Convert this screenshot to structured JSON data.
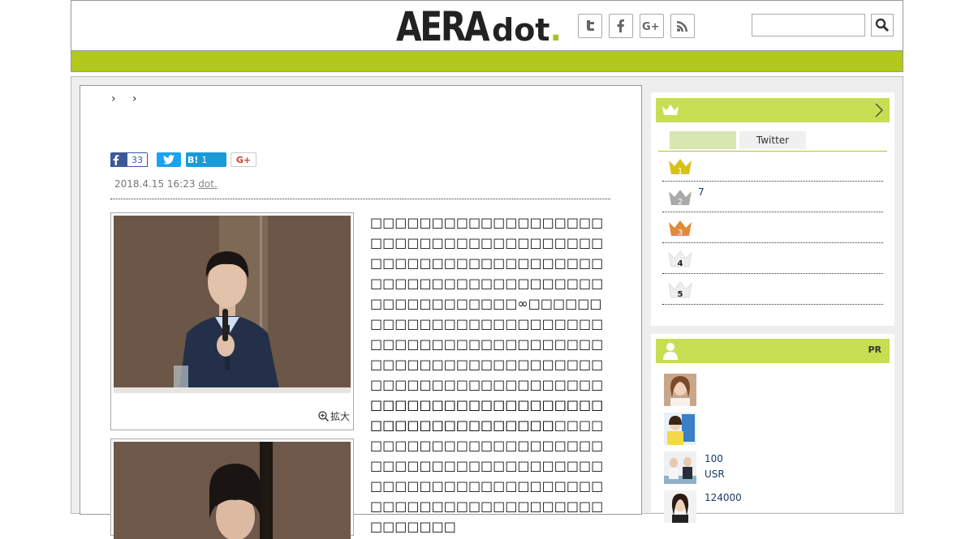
{
  "header": {
    "logo_main": "AERA",
    "logo_sub": "dot",
    "logo_point": ".",
    "social": [
      {
        "name": "twitter-icon",
        "glyph": "t"
      },
      {
        "name": "facebook-icon",
        "glyph": "f"
      },
      {
        "name": "google-plus-icon",
        "glyph": "G+"
      },
      {
        "name": "rss-icon",
        "glyph": ""
      }
    ],
    "search_placeholder": ""
  },
  "colors": {
    "accent_green": "#b0c91b",
    "sidebar_green": "#c8de52",
    "link_navy": "#1a3a6a"
  },
  "article": {
    "breadcrumb": "› ›",
    "share": {
      "facebook_count": "33",
      "hatena_label": "B!",
      "hatena_count": "1",
      "gplus_label": "G+"
    },
    "date": "2018.4.15 16:23",
    "source": "dot.",
    "zoom_label": "拡大",
    "paragraph1": "□□□□□□□□□□□□□□□□□□□□□□□□□□□□□□□□□□□□□□□□□□□□□□□□□□□□□□□□□□□□□□□□□□□□□□□□□□□□□□□□□□□□□□□□∞□□□□□□□□□□□□□□□□□□□□□□□□□□□□□□□□□□□□□□□□□□□□□□□□□□□□□□□□□□□□□□□□□□□□□□□□□□□□□□□□□□□□□□□□□□□□□□□□□□□□□□□□□□□□□□□□□□□□",
    "paragraph2": "□□□□□□□□□□□□□□□□□□□□□□□□□□□□□□□□□□□□□□□□□□□□□□□□□□□□□□□□□□□□□□□□□□□□□□□□□□□□□□□□□□□□□□□□□□□□□□□□□□□□□□□□□□□□□□□□□□□□□□□□□"
  },
  "sidebar": {
    "tabs": [
      "",
      "Twitter"
    ],
    "ranking": [
      {
        "rank": "1",
        "text": "",
        "color": "#d8c21a"
      },
      {
        "rank": "2",
        "text": "7",
        "color": "#aaaaaa"
      },
      {
        "rank": "3",
        "text": "",
        "color": "#e08a3a"
      },
      {
        "rank": "4",
        "text": "",
        "color": "#eeeeee"
      },
      {
        "rank": "5",
        "text": "",
        "color": "#eeeeee"
      }
    ],
    "pr_label": "PR",
    "pr_items": [
      {
        "line1": "",
        "line2": ""
      },
      {
        "line1": "",
        "line2": ""
      },
      {
        "line1": "100",
        "line2": "USR"
      },
      {
        "line1": "124000",
        "line2": ""
      }
    ]
  }
}
